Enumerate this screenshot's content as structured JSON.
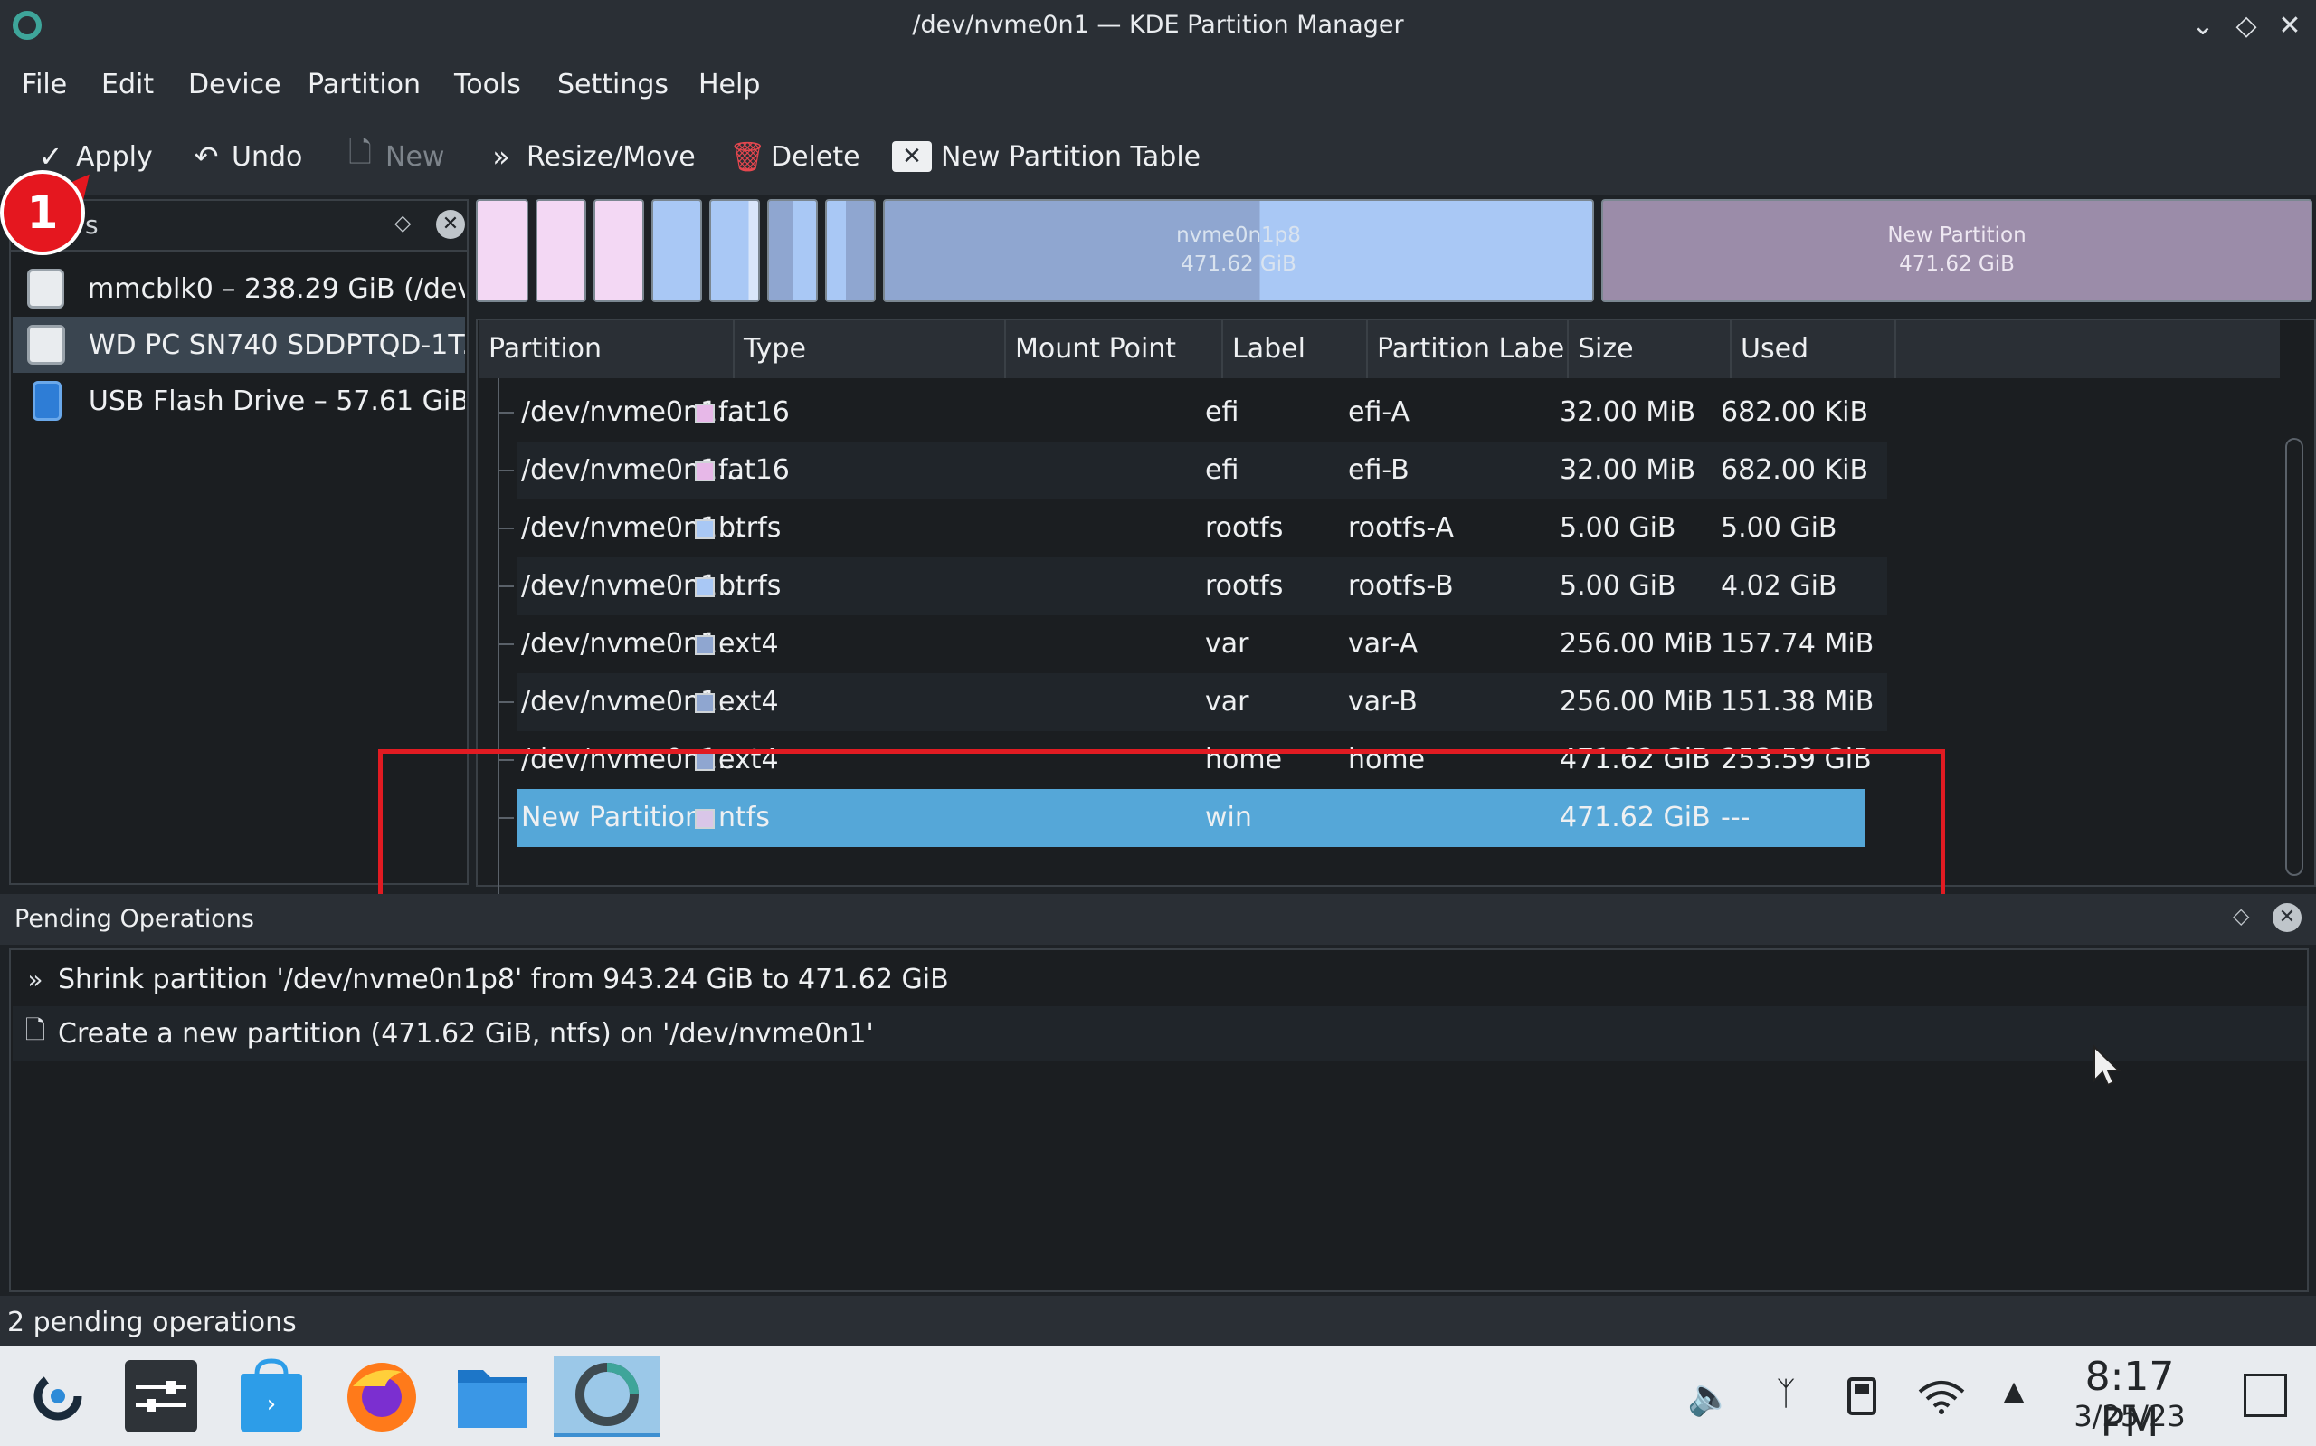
{
  "window": {
    "title": "/dev/nvme0n1 — KDE Partition Manager",
    "controls": [
      "⌄",
      "◇",
      "✕"
    ]
  },
  "menubar": [
    "File",
    "Edit",
    "Device",
    "Partition",
    "Tools",
    "Settings",
    "Help"
  ],
  "toolbar": {
    "apply": "Apply",
    "undo": "Undo",
    "new": "New",
    "resize_move": "Resize/Move",
    "delete": "Delete",
    "new_partition_table": "New Partition Table"
  },
  "annotation": {
    "badge": "1"
  },
  "devices": {
    "filter_text": "s",
    "items": [
      {
        "label": "mmcblk0 – 238.29 GiB (/dev...",
        "icon": "drive-icon"
      },
      {
        "label": "WD PC SN740 SDDPTQD-1T...",
        "icon": "drive-icon",
        "selected": true
      },
      {
        "label": "USB Flash Drive – 57.61 GiB...",
        "icon": "usb-drive-icon"
      }
    ]
  },
  "partition_bar": {
    "big1": {
      "name": "nvme0n1p8",
      "size": "471.62 GiB"
    },
    "big2": {
      "name": "New Partition",
      "size": "471.62 GiB"
    }
  },
  "table": {
    "columns": [
      "Partition",
      "Type",
      "Mount Point",
      "Label",
      "Partition Labe",
      "Size",
      "Used"
    ],
    "rows": [
      {
        "partition": "/dev/nvme0n1...",
        "type": "fat16",
        "swatch": "#e7b8e8",
        "mount": "",
        "label": "efi",
        "plabel": "efi-A",
        "size": "32.00 MiB",
        "used": "682.00 KiB"
      },
      {
        "partition": "/dev/nvme0n1...",
        "type": "fat16",
        "swatch": "#e7b8e8",
        "mount": "",
        "label": "efi",
        "plabel": "efi-B",
        "size": "32.00 MiB",
        "used": "682.00 KiB"
      },
      {
        "partition": "/dev/nvme0n1...",
        "type": "btrfs",
        "swatch": "#a9c8f5",
        "mount": "",
        "label": "rootfs",
        "plabel": "rootfs-A",
        "size": "5.00 GiB",
        "used": "5.00 GiB"
      },
      {
        "partition": "/dev/nvme0n1...",
        "type": "btrfs",
        "swatch": "#a9c8f5",
        "mount": "",
        "label": "rootfs",
        "plabel": "rootfs-B",
        "size": "5.00 GiB",
        "used": "4.02 GiB"
      },
      {
        "partition": "/dev/nvme0n1...",
        "type": "ext4",
        "swatch": "#8fa6d0",
        "mount": "",
        "label": "var",
        "plabel": "var-A",
        "size": "256.00 MiB",
        "used": "157.74 MiB"
      },
      {
        "partition": "/dev/nvme0n1...",
        "type": "ext4",
        "swatch": "#8fa6d0",
        "mount": "",
        "label": "var",
        "plabel": "var-B",
        "size": "256.00 MiB",
        "used": "151.38 MiB"
      },
      {
        "partition": "/dev/nvme0n1...",
        "type": "ext4",
        "swatch": "#8fa6d0",
        "mount": "",
        "label": "home",
        "plabel": "home",
        "size": "471.62 GiB",
        "used": "253.59 GiB"
      },
      {
        "partition": "New Partition",
        "type": "ntfs",
        "swatch": "#d9c6e8",
        "mount": "",
        "label": "win",
        "plabel": "",
        "size": "471.62 GiB",
        "used": "---",
        "selected": true
      }
    ]
  },
  "pending": {
    "title": "Pending Operations",
    "ops": [
      "Shrink partition '/dev/nvme0n1p8' from 943.24 GiB to 471.62 GiB",
      "Create a new partition (471.62 GiB, ntfs) on '/dev/nvme0n1'"
    ]
  },
  "statusbar": "2 pending operations",
  "taskbar": {
    "apps": [
      "steam-icon",
      "system-settings-icon",
      "discover-store-icon",
      "firefox-icon",
      "file-manager-icon",
      "partition-manager-icon"
    ],
    "tray": [
      "volume-icon",
      "bluetooth-icon",
      "usb-storage-icon",
      "wifi-icon",
      "tray-expand-icon"
    ],
    "time": "8:17 PM",
    "date": "3/25/23"
  },
  "colors": {
    "selection": "#55a7d8",
    "highlight_box": "#e11b22",
    "badge": "#e5171f"
  }
}
